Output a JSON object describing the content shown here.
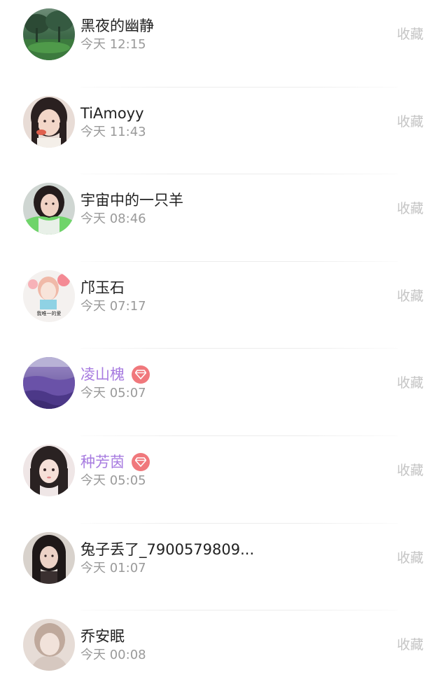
{
  "items": [
    {
      "name": "黑夜的幽静",
      "time": "今天 12:15",
      "action": "收藏",
      "vip": false,
      "avatar": "forest-photo"
    },
    {
      "name": "TiAmoyy",
      "time": "今天 11:43",
      "action": "收藏",
      "vip": false,
      "avatar": "girl-portrait"
    },
    {
      "name": "宇宙中的一只羊",
      "time": "今天 08:46",
      "action": "收藏",
      "vip": false,
      "avatar": "girl-green-jacket"
    },
    {
      "name": "邝玉石",
      "time": "今天 07:17",
      "action": "收藏",
      "vip": false,
      "avatar": "girl-pink-balloons",
      "avatar_caption": "我唯一的爱"
    },
    {
      "name": "凌山槐",
      "time": "今天 05:07",
      "action": "收藏",
      "vip": true,
      "avatar": "lavender-field"
    },
    {
      "name": "种芳茵",
      "time": "今天 05:05",
      "action": "收藏",
      "vip": true,
      "avatar": "girl-long-hair"
    },
    {
      "name": "兔子丢了_7900579809...",
      "time": "今天 01:07",
      "action": "收藏",
      "vip": false,
      "avatar": "girl-dark-portrait"
    },
    {
      "name": "乔安眠",
      "time": "今天 00:08",
      "action": "收藏",
      "vip": false,
      "avatar": "girl-pale-portrait"
    }
  ],
  "colors": {
    "vip_name": "#a77be0",
    "vip_badge": "#f0787c",
    "name": "#222222",
    "time": "#9a9a9a",
    "action": "#c4c4c4"
  },
  "icons": {
    "vip_badge": "diamond-icon"
  }
}
